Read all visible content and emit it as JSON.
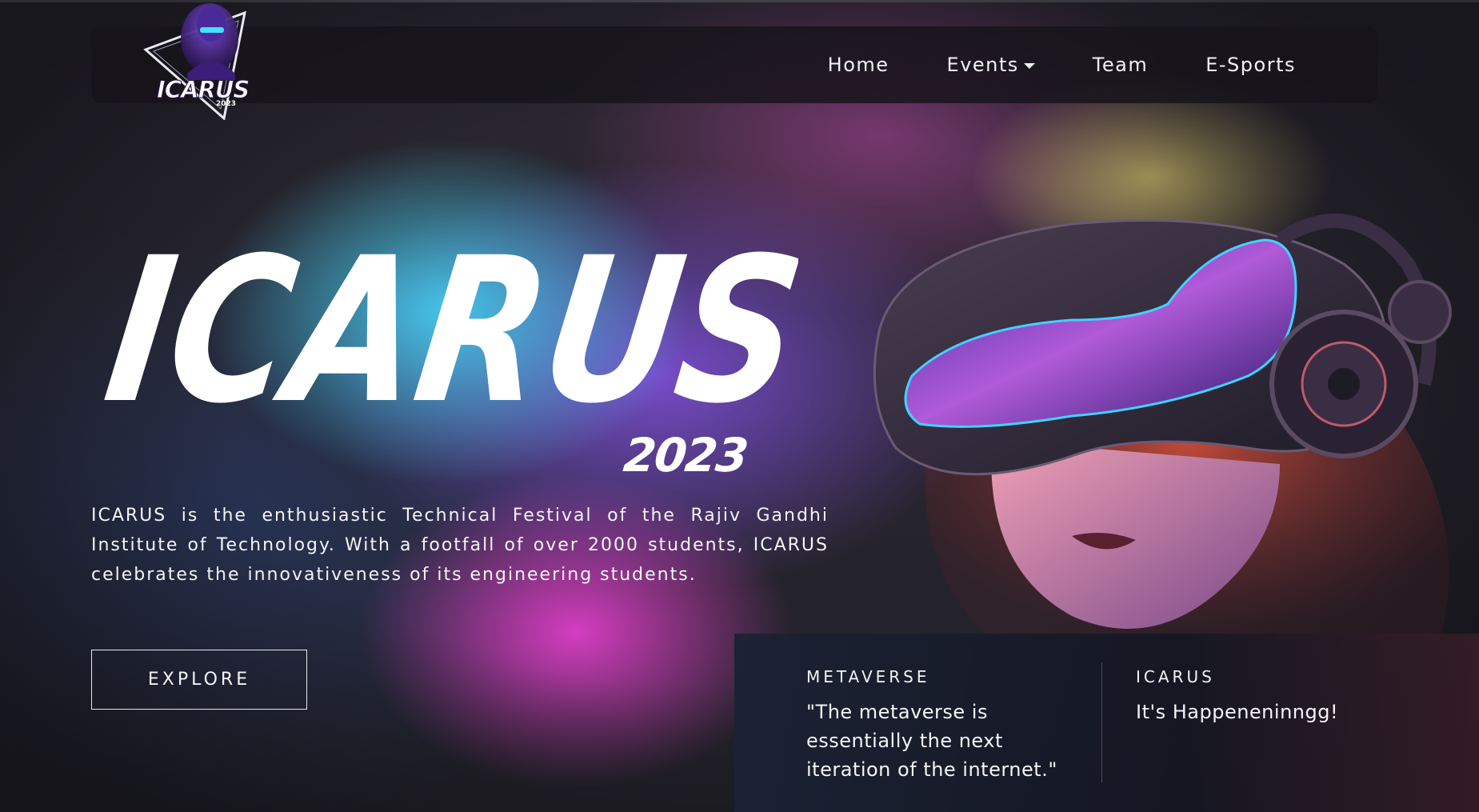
{
  "nav": {
    "logo": {
      "text": "ICARUS",
      "year": "2023"
    },
    "links": [
      {
        "label": "Home"
      },
      {
        "label": "Events",
        "has_dropdown": true
      },
      {
        "label": "Team"
      },
      {
        "label": "E-Sports"
      }
    ]
  },
  "hero": {
    "title": "ICARUS",
    "year": "2023",
    "description": "ICARUS is the enthusiastic Technical Festival of the Rajiv Gandhi Institute of Technology. With a footfall of over 2000 students, ICARUS celebrates the innovativeness of its engineering students.",
    "explore_label": "EXPLORE"
  },
  "info": {
    "metaverse": {
      "heading": "METAVERSE",
      "text": "\"The metaverse is essentially the next iteration of the internet.\""
    },
    "icarus": {
      "heading": "ICARUS",
      "text": "It's Happeneninngg!"
    }
  },
  "colors": {
    "accent_cyan": "#46cdf0",
    "accent_magenta": "#de3ec8",
    "accent_purple": "#8050dc",
    "navbar_bg": "#16141a",
    "text": "#f4f4f6"
  },
  "icons": {
    "logo": "icarus-logo-icon",
    "dropdown": "caret-down-icon"
  }
}
